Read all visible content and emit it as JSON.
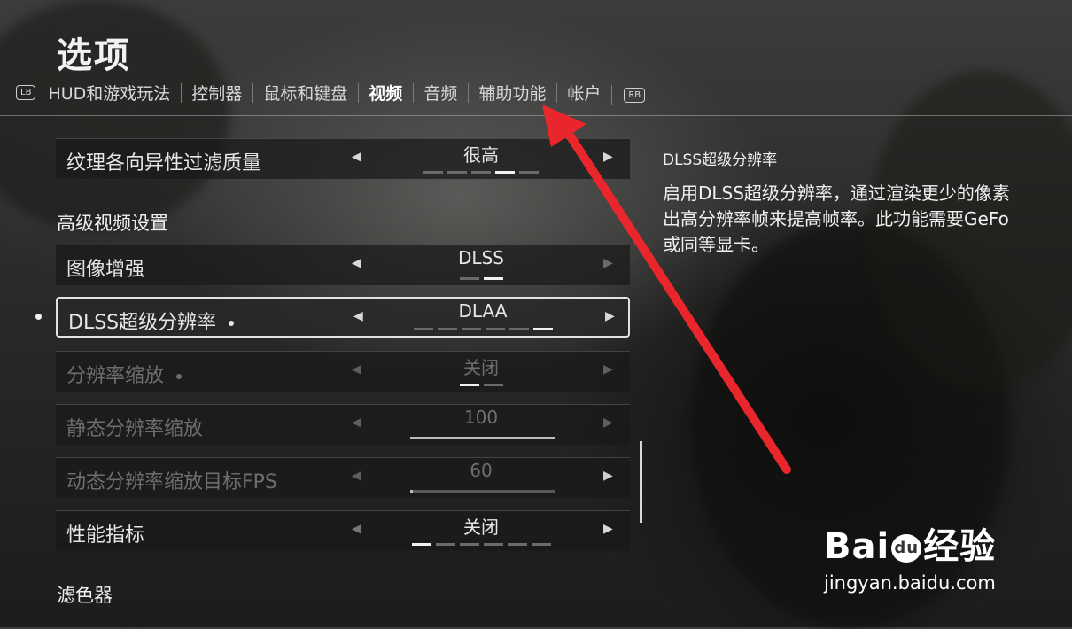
{
  "page": {
    "title": "选项"
  },
  "tabs": {
    "left_bumper": "LB",
    "right_bumper": "RB",
    "items": [
      {
        "label": "HUD和游戏玩法"
      },
      {
        "label": "控制器"
      },
      {
        "label": "鼠标和键盘"
      },
      {
        "label": "视频",
        "active": true
      },
      {
        "label": "音频"
      },
      {
        "label": "辅助功能"
      },
      {
        "label": "帐户"
      }
    ]
  },
  "settings": {
    "texture_filtering": {
      "label": "纹理各向异性过滤质量",
      "value": "很高",
      "level": 4,
      "levels": 5
    },
    "advanced_header": "高级视频设置",
    "image_enhance": {
      "label": "图像增强",
      "value": "DLSS",
      "level": 2,
      "levels": 2
    },
    "dlss": {
      "label": "DLSS超级分辨率",
      "value": "DLAA",
      "level": 6,
      "levels": 6
    },
    "resolution_scale": {
      "label": "分辨率缩放",
      "value": "关闭",
      "level": 1,
      "levels": 2
    },
    "static_scale": {
      "label": "静态分辨率缩放",
      "value": "100",
      "fraction": 1.0
    },
    "dynamic_target": {
      "label": "动态分辨率缩放目标FPS",
      "value": "60",
      "fraction": 0.02
    },
    "perf_metrics": {
      "label": "性能指标",
      "value": "关闭",
      "level": 1,
      "levels": 6
    },
    "filters_header": "滤色器"
  },
  "description": {
    "title": "DLSS超级分辨率",
    "text": "启用DLSS超级分辨率，通过渲染更少的像素\n出高分辨率帧来提高帧率。此功能需要GeFo\n或同等显卡。"
  },
  "watermark": {
    "brand_left": "Bai",
    "brand_du": "du",
    "brand_right": "经验",
    "url": "jingyan.baidu.com"
  },
  "colors": {
    "annotation_arrow": "#e8262b"
  }
}
